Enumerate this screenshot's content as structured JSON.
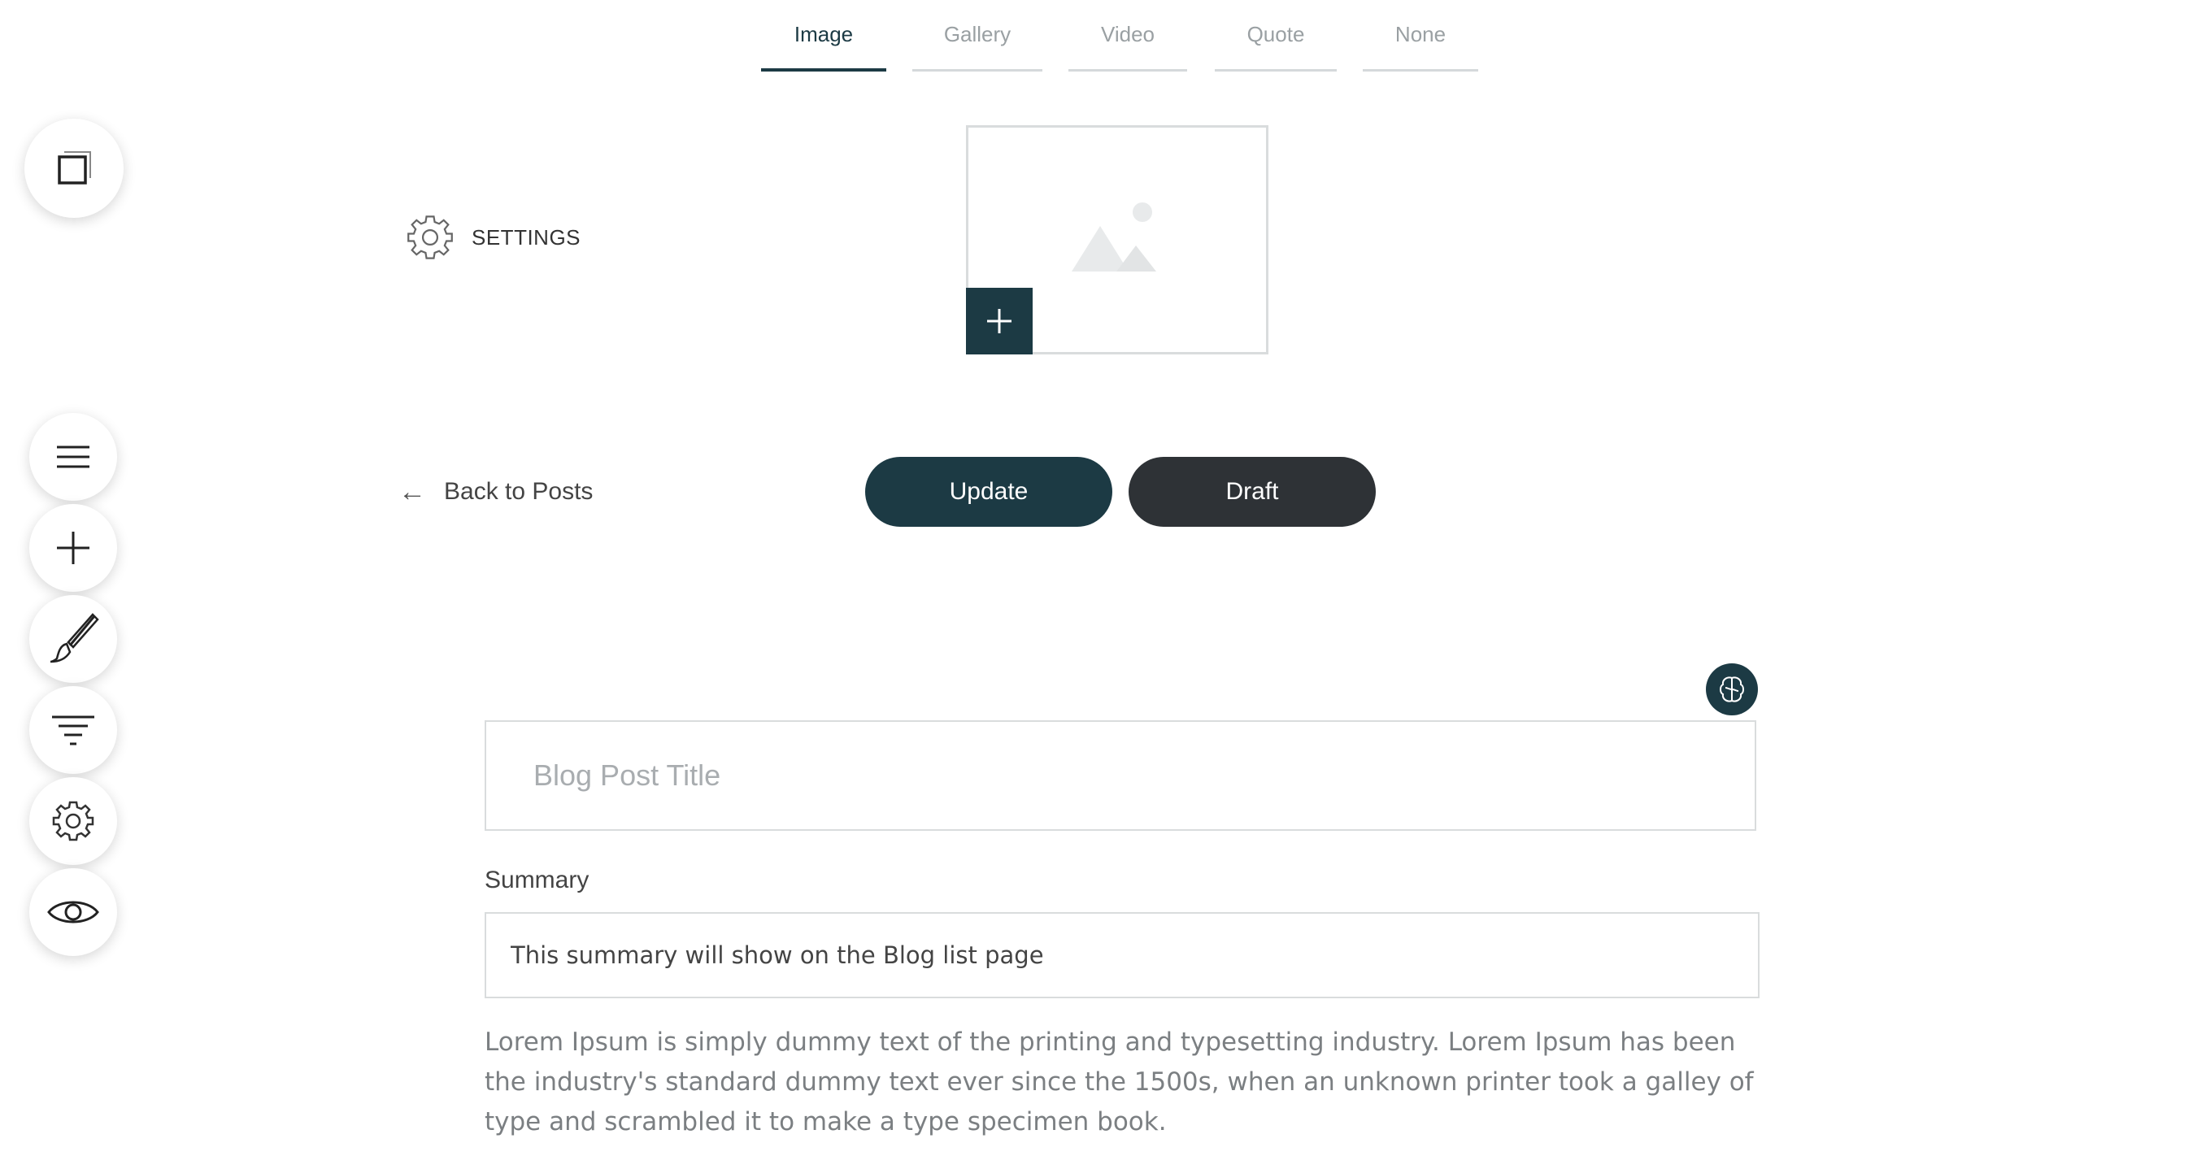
{
  "tabs": [
    {
      "label": "Image",
      "active": true
    },
    {
      "label": "Gallery",
      "active": false
    },
    {
      "label": "Video",
      "active": false
    },
    {
      "label": "Quote",
      "active": false
    },
    {
      "label": "None",
      "active": false
    }
  ],
  "sidebar": {
    "top_button_icon": "pages-copy-icon",
    "items": [
      {
        "icon": "menu-icon"
      },
      {
        "icon": "plus-icon"
      },
      {
        "icon": "brush-icon"
      },
      {
        "icon": "filter-icon"
      },
      {
        "icon": "gear-icon"
      },
      {
        "icon": "eye-icon"
      }
    ]
  },
  "settings": {
    "label": "SETTINGS",
    "icon": "gear-icon"
  },
  "media": {
    "placeholder_icon": "image-placeholder-icon",
    "add_icon": "plus-icon"
  },
  "nav": {
    "back_arrow": "←",
    "back_label": "Back to Posts"
  },
  "actions": {
    "update_label": "Update",
    "draft_label": "Draft"
  },
  "ai": {
    "icon": "brain-icon"
  },
  "form": {
    "title_placeholder": "Blog Post Title",
    "title_value": "",
    "summary_label": "Summary",
    "summary_placeholder": "This summary will show on the Blog list page",
    "body": "Lorem Ipsum is simply dummy text of the printing and typesetting industry. Lorem Ipsum has been the industry's standard dummy text ever since the 1500s, when an unknown printer took a galley of type and scrambled it to make a type specimen book."
  },
  "colors": {
    "accent": "#1c3a44",
    "draft": "#2e3236",
    "border": "#d9dcdd"
  }
}
